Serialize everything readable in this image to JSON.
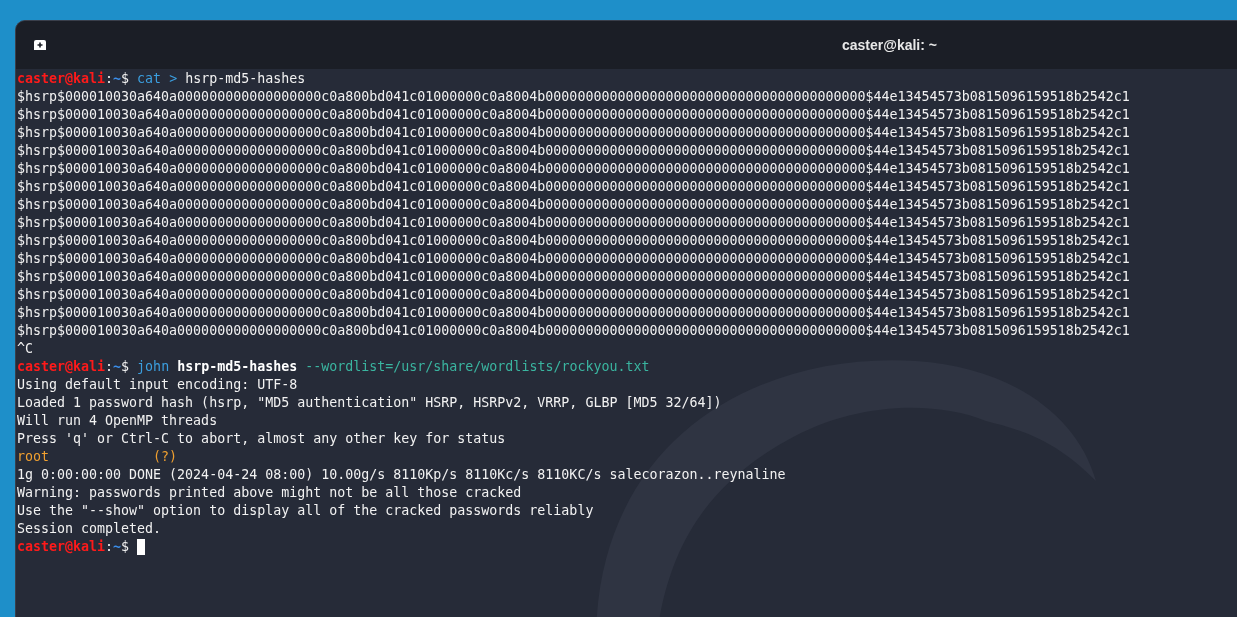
{
  "window": {
    "title": "caster@kali: ~"
  },
  "lines": [
    {
      "segments": [
        {
          "kind": "user",
          "text": "caster@kali"
        },
        {
          "kind": "plain",
          "text": ":"
        },
        {
          "kind": "path",
          "text": "~"
        },
        {
          "kind": "plain",
          "text": "$ "
        },
        {
          "kind": "command",
          "text": "cat >"
        },
        {
          "kind": "plain",
          "text": " hsrp-md5-hashes"
        }
      ]
    },
    {
      "segments": [
        {
          "kind": "plain",
          "text": "$hsrp$000010030a640a000000000000000000c0a800bd041c01000000c0a8004b0000000000000000000000000000000000000000$44e13454573b0815096159518b2542c1"
        }
      ]
    },
    {
      "segments": [
        {
          "kind": "plain",
          "text": "$hsrp$000010030a640a000000000000000000c0a800bd041c01000000c0a8004b0000000000000000000000000000000000000000$44e13454573b0815096159518b2542c1"
        }
      ]
    },
    {
      "segments": [
        {
          "kind": "plain",
          "text": "$hsrp$000010030a640a000000000000000000c0a800bd041c01000000c0a8004b0000000000000000000000000000000000000000$44e13454573b0815096159518b2542c1"
        }
      ]
    },
    {
      "segments": [
        {
          "kind": "plain",
          "text": "$hsrp$000010030a640a000000000000000000c0a800bd041c01000000c0a8004b0000000000000000000000000000000000000000$44e13454573b0815096159518b2542c1"
        }
      ]
    },
    {
      "segments": [
        {
          "kind": "plain",
          "text": "$hsrp$000010030a640a000000000000000000c0a800bd041c01000000c0a8004b0000000000000000000000000000000000000000$44e13454573b0815096159518b2542c1"
        }
      ]
    },
    {
      "segments": [
        {
          "kind": "plain",
          "text": "$hsrp$000010030a640a000000000000000000c0a800bd041c01000000c0a8004b0000000000000000000000000000000000000000$44e13454573b0815096159518b2542c1"
        }
      ]
    },
    {
      "segments": [
        {
          "kind": "plain",
          "text": "$hsrp$000010030a640a000000000000000000c0a800bd041c01000000c0a8004b0000000000000000000000000000000000000000$44e13454573b0815096159518b2542c1"
        }
      ]
    },
    {
      "segments": [
        {
          "kind": "plain",
          "text": "$hsrp$000010030a640a000000000000000000c0a800bd041c01000000c0a8004b0000000000000000000000000000000000000000$44e13454573b0815096159518b2542c1"
        }
      ]
    },
    {
      "segments": [
        {
          "kind": "plain",
          "text": "$hsrp$000010030a640a000000000000000000c0a800bd041c01000000c0a8004b0000000000000000000000000000000000000000$44e13454573b0815096159518b2542c1"
        }
      ]
    },
    {
      "segments": [
        {
          "kind": "plain",
          "text": "$hsrp$000010030a640a000000000000000000c0a800bd041c01000000c0a8004b0000000000000000000000000000000000000000$44e13454573b0815096159518b2542c1"
        }
      ]
    },
    {
      "segments": [
        {
          "kind": "plain",
          "text": "$hsrp$000010030a640a000000000000000000c0a800bd041c01000000c0a8004b0000000000000000000000000000000000000000$44e13454573b0815096159518b2542c1"
        }
      ]
    },
    {
      "segments": [
        {
          "kind": "plain",
          "text": "$hsrp$000010030a640a000000000000000000c0a800bd041c01000000c0a8004b0000000000000000000000000000000000000000$44e13454573b0815096159518b2542c1"
        }
      ]
    },
    {
      "segments": [
        {
          "kind": "plain",
          "text": "$hsrp$000010030a640a000000000000000000c0a800bd041c01000000c0a8004b0000000000000000000000000000000000000000$44e13454573b0815096159518b2542c1"
        }
      ]
    },
    {
      "segments": [
        {
          "kind": "plain",
          "text": "$hsrp$000010030a640a000000000000000000c0a800bd041c01000000c0a8004b0000000000000000000000000000000000000000$44e13454573b0815096159518b2542c1"
        }
      ]
    },
    {
      "segments": [
        {
          "kind": "plain",
          "text": "^C"
        }
      ]
    },
    {
      "segments": [
        {
          "kind": "user",
          "text": "caster@kali"
        },
        {
          "kind": "plain",
          "text": ":"
        },
        {
          "kind": "path",
          "text": "~"
        },
        {
          "kind": "plain",
          "text": "$ "
        },
        {
          "kind": "command",
          "text": "john "
        },
        {
          "kind": "argument",
          "text": "hsrp-md5-hashes "
        },
        {
          "kind": "option",
          "text": "--wordlist=/usr/share/wordlists/rockyou.txt"
        }
      ]
    },
    {
      "segments": [
        {
          "kind": "plain",
          "text": "Using default input encoding: UTF-8"
        }
      ]
    },
    {
      "segments": [
        {
          "kind": "plain",
          "text": "Loaded 1 password hash (hsrp, \"MD5 authentication\" HSRP, HSRPv2, VRRP, GLBP [MD5 32/64])"
        }
      ]
    },
    {
      "segments": [
        {
          "kind": "plain",
          "text": "Will run 4 OpenMP threads"
        }
      ]
    },
    {
      "segments": [
        {
          "kind": "plain",
          "text": "Press 'q' or Ctrl-C to abort, almost any other key for status"
        }
      ]
    },
    {
      "segments": [
        {
          "kind": "found",
          "text": "root             (?)"
        }
      ]
    },
    {
      "segments": [
        {
          "kind": "plain",
          "text": "1g 0:00:00:00 DONE (2024-04-24 08:00) 10.00g/s 8110Kp/s 8110Kc/s 8110KC/s salecorazon..reynaline"
        }
      ]
    },
    {
      "segments": [
        {
          "kind": "plain",
          "text": "Warning: passwords printed above might not be all those cracked"
        }
      ]
    },
    {
      "segments": [
        {
          "kind": "plain",
          "text": "Use the \"--show\" option to display all of the cracked passwords reliably"
        }
      ]
    },
    {
      "segments": [
        {
          "kind": "plain",
          "text": "Session completed."
        }
      ]
    },
    {
      "segments": [
        {
          "kind": "user",
          "text": "caster@kali"
        },
        {
          "kind": "plain",
          "text": ":"
        },
        {
          "kind": "path",
          "text": "~"
        },
        {
          "kind": "plain",
          "text": "$ "
        }
      ],
      "cursor": true
    }
  ]
}
